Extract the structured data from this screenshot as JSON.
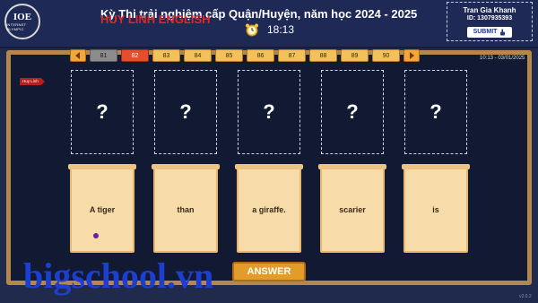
{
  "header": {
    "logo": {
      "main": "IOE",
      "sub": "INTERNET OLYMPIC"
    },
    "exam_title": "Kỳ Thi trải nghiệm cấp Quận/Huyện, năm học 2024 - 2025",
    "watermark": "HUY LINH ENGLISH",
    "timer_icon": "alarm-clock-icon",
    "timer": "18:13",
    "user": {
      "name": "Tran Gia Khanh",
      "id": "ID: 1307935393",
      "submit_label": "SUBMIT",
      "submit_icon": "pointer-hand-icon"
    }
  },
  "navigation": {
    "prev_icon": "chevron-left-icon",
    "next_icon": "chevron-right-icon",
    "questions": [
      "81",
      "82",
      "83",
      "84",
      "85",
      "86",
      "87",
      "88",
      "89",
      "90"
    ],
    "current": "82",
    "completed": [
      "81"
    ]
  },
  "datetime": "10:13 - 03/01/2025",
  "tag": "Huy Linh",
  "slots": [
    "?",
    "?",
    "?",
    "?",
    "?"
  ],
  "cards": [
    "A tiger",
    "than",
    "a giraffe.",
    "scarier",
    "is"
  ],
  "answer_label": "ANSWER",
  "watermark_bottom": "bigschool.vn",
  "version": "v2.0.2",
  "colors": {
    "header_bg": "#1e2a55",
    "board_border": "#b6874d",
    "card_bg": "#f7dcaa",
    "answer_button": "#e39b2a",
    "current_question": "#e34e2c",
    "watermark_red": "#e0262b",
    "watermark_blue": "#1c3fd0"
  }
}
